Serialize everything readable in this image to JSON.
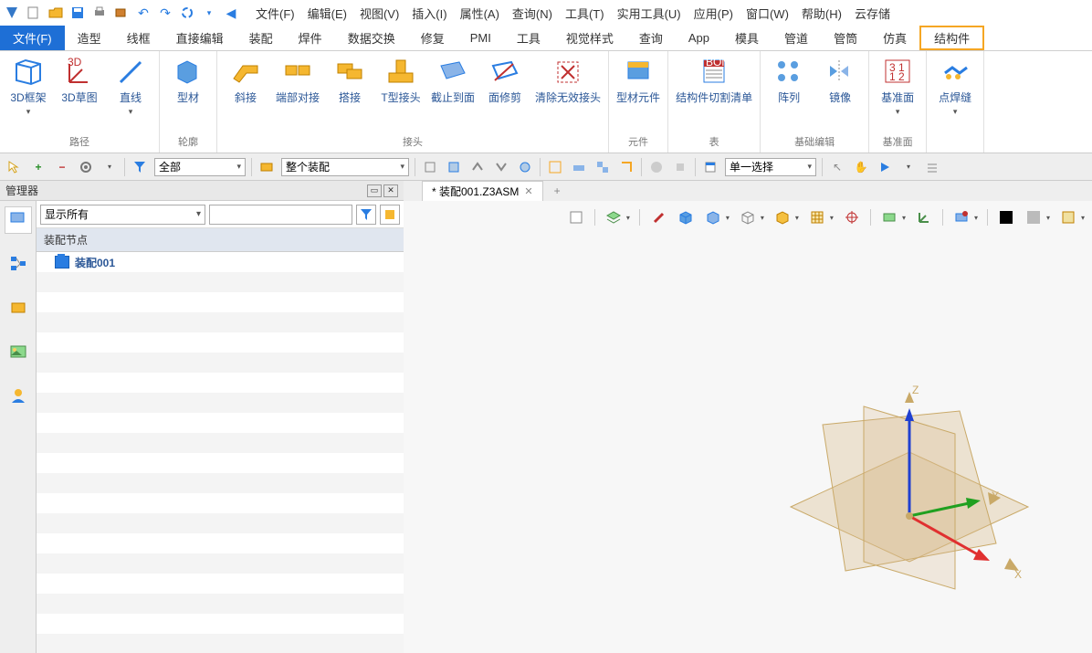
{
  "qat_icons": [
    "app",
    "new",
    "open",
    "save",
    "print",
    "export",
    "undo",
    "redo",
    "sync",
    "dropdown",
    "back"
  ],
  "menus": [
    "文件(F)",
    "编辑(E)",
    "视图(V)",
    "插入(I)",
    "属性(A)",
    "查询(N)",
    "工具(T)",
    "实用工具(U)",
    "应用(P)",
    "窗口(W)",
    "帮助(H)",
    "云存储"
  ],
  "ribbon_tabs": [
    "文件(F)",
    "造型",
    "线框",
    "直接编辑",
    "装配",
    "焊件",
    "数据交换",
    "修复",
    "PMI",
    "工具",
    "视觉样式",
    "查询",
    "App",
    "模具",
    "管道",
    "管筒",
    "仿真",
    "结构件"
  ],
  "ribbon_active_tab": 0,
  "ribbon_highlighted_tab": 17,
  "ribbon_groups": [
    {
      "title": "路径",
      "buttons": [
        {
          "label": "3D框架",
          "icon": "frame3d",
          "dd": true
        },
        {
          "label": "3D草图",
          "icon": "sketch3d"
        },
        {
          "label": "直线",
          "icon": "line",
          "dd": true
        }
      ]
    },
    {
      "title": "轮廓",
      "buttons": [
        {
          "label": "型材",
          "icon": "profile"
        }
      ]
    },
    {
      "title": "接头",
      "buttons": [
        {
          "label": "斜接",
          "icon": "miter"
        },
        {
          "label": "端部对接",
          "icon": "butt"
        },
        {
          "label": "搭接",
          "icon": "lap"
        },
        {
          "label": "T型接头",
          "icon": "tjoint"
        },
        {
          "label": "截止到面",
          "icon": "trimface"
        },
        {
          "label": "面修剪",
          "icon": "facetrim"
        },
        {
          "label": "清除无效接头",
          "icon": "clearjoint"
        }
      ]
    },
    {
      "title": "元件",
      "buttons": [
        {
          "label": "型材元件",
          "icon": "component"
        }
      ]
    },
    {
      "title": "表",
      "buttons": [
        {
          "label": "结构件切割清单",
          "icon": "bom"
        }
      ]
    },
    {
      "title": "基础编辑",
      "buttons": [
        {
          "label": "阵列",
          "icon": "pattern"
        },
        {
          "label": "镜像",
          "icon": "mirror"
        }
      ]
    },
    {
      "title": "基准面",
      "buttons": [
        {
          "label": "基准面",
          "icon": "datum",
          "dd": true
        }
      ]
    },
    {
      "title": "",
      "buttons": [
        {
          "label": "点焊缝",
          "icon": "weld",
          "dd": true
        }
      ]
    }
  ],
  "filterbar": {
    "entity_filter": "全部",
    "scope_filter": "整个装配",
    "select_mode": "单一选择"
  },
  "manager": {
    "title": "管理器",
    "show_filter": "显示所有",
    "tree_header": "装配节点",
    "root_node": "装配001"
  },
  "doc": {
    "tab_title": "* 装配001.Z3ASM"
  },
  "axes_labels": {
    "x": "X",
    "y": "Y",
    "z": "Z"
  },
  "colors": {
    "accent": "#1e6fd6",
    "highlight": "#f5a623",
    "axis_x": "#e03030",
    "axis_y": "#20a020",
    "axis_z": "#2040d0",
    "plane": "#c9a968"
  }
}
